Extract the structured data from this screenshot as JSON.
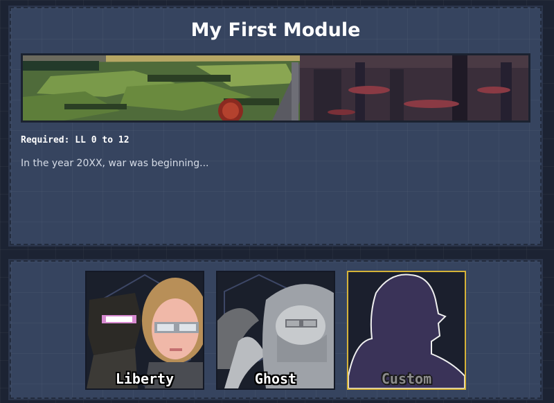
{
  "module": {
    "title": "My First Module",
    "requirement": "Required: LL 0 to 12",
    "description": "In the year 20XX, war was beginning..."
  },
  "pilots": [
    {
      "name": "Liberty",
      "portrait": "armored-mech-and-blonde-pilot-portrait",
      "selected": false
    },
    {
      "name": "Ghost",
      "portrait": "hooded-masked-pilot-portrait",
      "selected": false
    },
    {
      "name": "Custom",
      "portrait": "silhouette-placeholder-portrait",
      "selected": true
    }
  ],
  "colors": {
    "background": "#1c2333",
    "panel": "#36445f",
    "selected_border": "#d6b338",
    "silhouette": "#3a3358"
  }
}
